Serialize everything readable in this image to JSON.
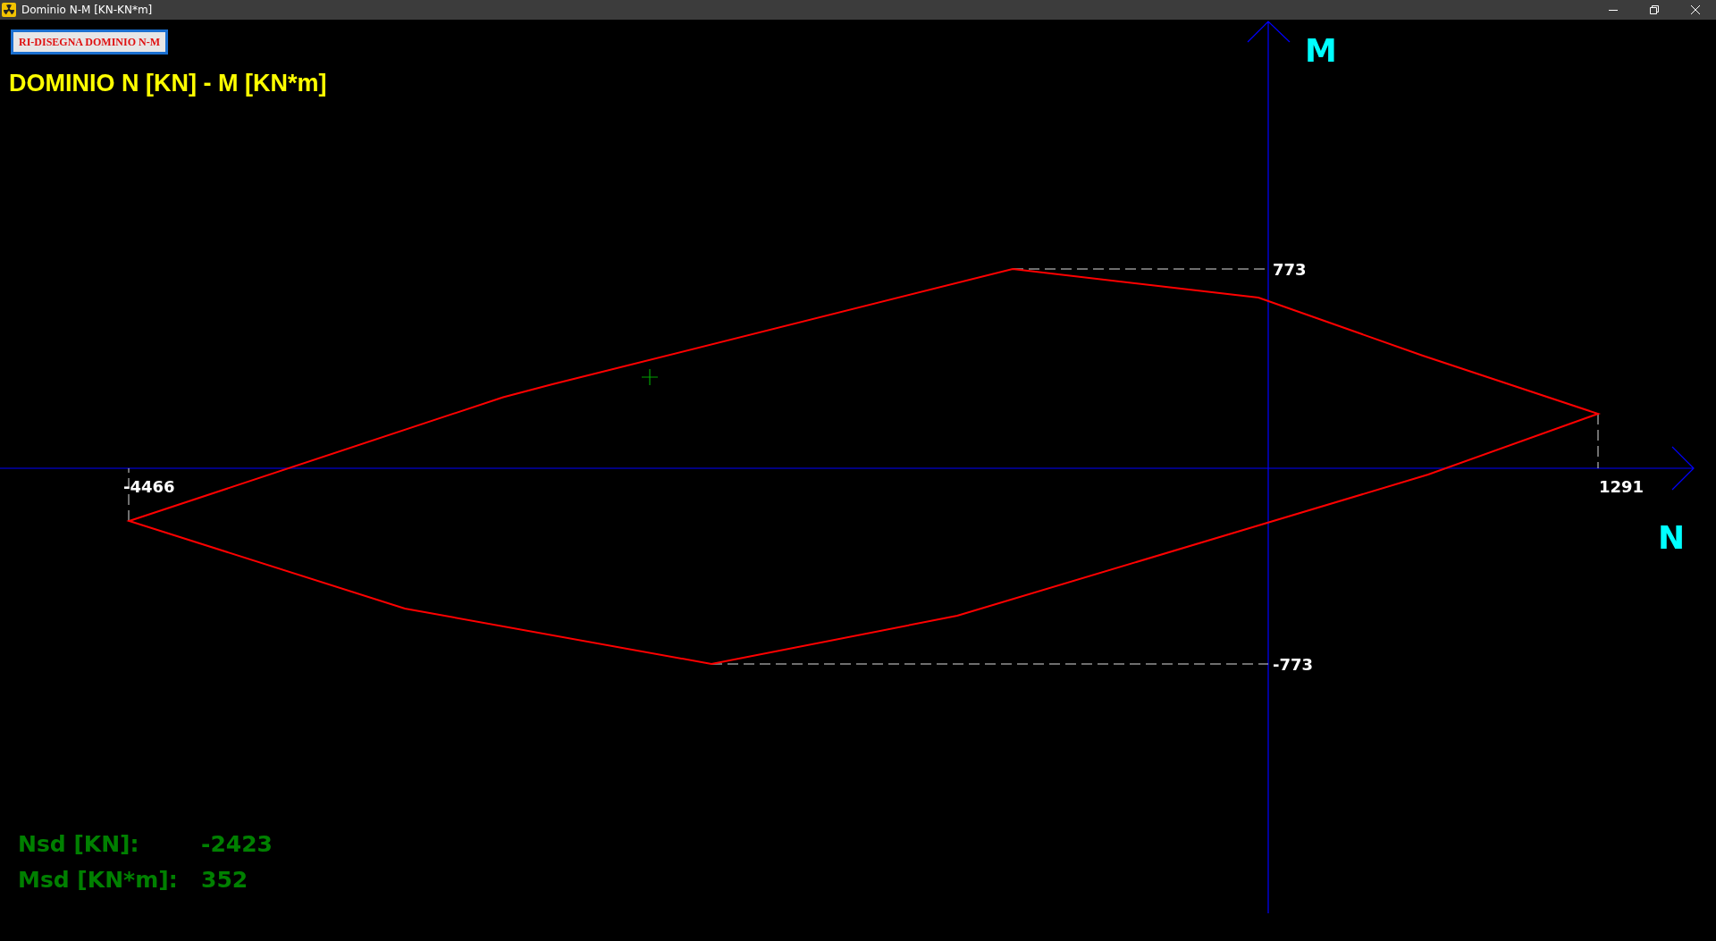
{
  "window": {
    "title": "Dominio N-M [KN-KN*m]"
  },
  "redraw_button": "RI-DISEGNA DOMINIO N-M",
  "heading": "DOMINIO N [KN] - M [KN*m]",
  "axes": {
    "m_label": "M",
    "n_label": "N"
  },
  "marks": [
    {
      "kind": "m_max",
      "text": "773"
    },
    {
      "kind": "m_min",
      "text": "-773"
    },
    {
      "kind": "n_min",
      "text": "-4466"
    },
    {
      "kind": "n_max",
      "text": "1291"
    }
  ],
  "readouts": [
    {
      "label": "Nsd [KN]:",
      "value": "-2423"
    },
    {
      "label": "Msd [KN*m]:",
      "value": "352"
    }
  ]
}
